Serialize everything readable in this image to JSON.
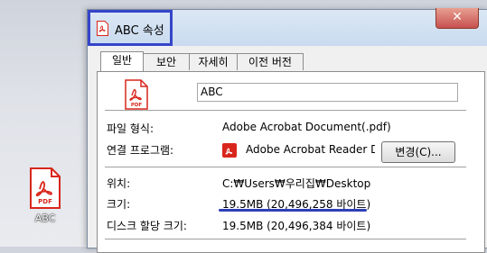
{
  "window": {
    "title": "ABC 속성",
    "close_label": "✕"
  },
  "tabs": [
    "일반",
    "보안",
    "자세히",
    "이전 버전"
  ],
  "active_tab": 0,
  "general": {
    "file_name": "ABC",
    "file_type_label": "파일 형식:",
    "file_type_value": "Adobe Acrobat Document(.pdf)",
    "opens_with_label": "연결 프로그램:",
    "opens_with_value": "Adobe Acrobat Reader DC",
    "change_button": "변경(C)...",
    "location_label": "위치:",
    "location_value": "C:₩Users₩우리집₩Desktop",
    "size_label": "크기:",
    "size_value": "19.5MB (20,496,258 바이트)",
    "size_on_disk_label": "디스크 할당 크기:",
    "size_on_disk_value": "19.5MB (20,496,384 바이트)"
  },
  "desktop": {
    "icon_label": "ABC",
    "icon_badge": "PDF"
  },
  "colors": {
    "highlight": "#3545c8",
    "pdf_red": "#d9261c"
  }
}
